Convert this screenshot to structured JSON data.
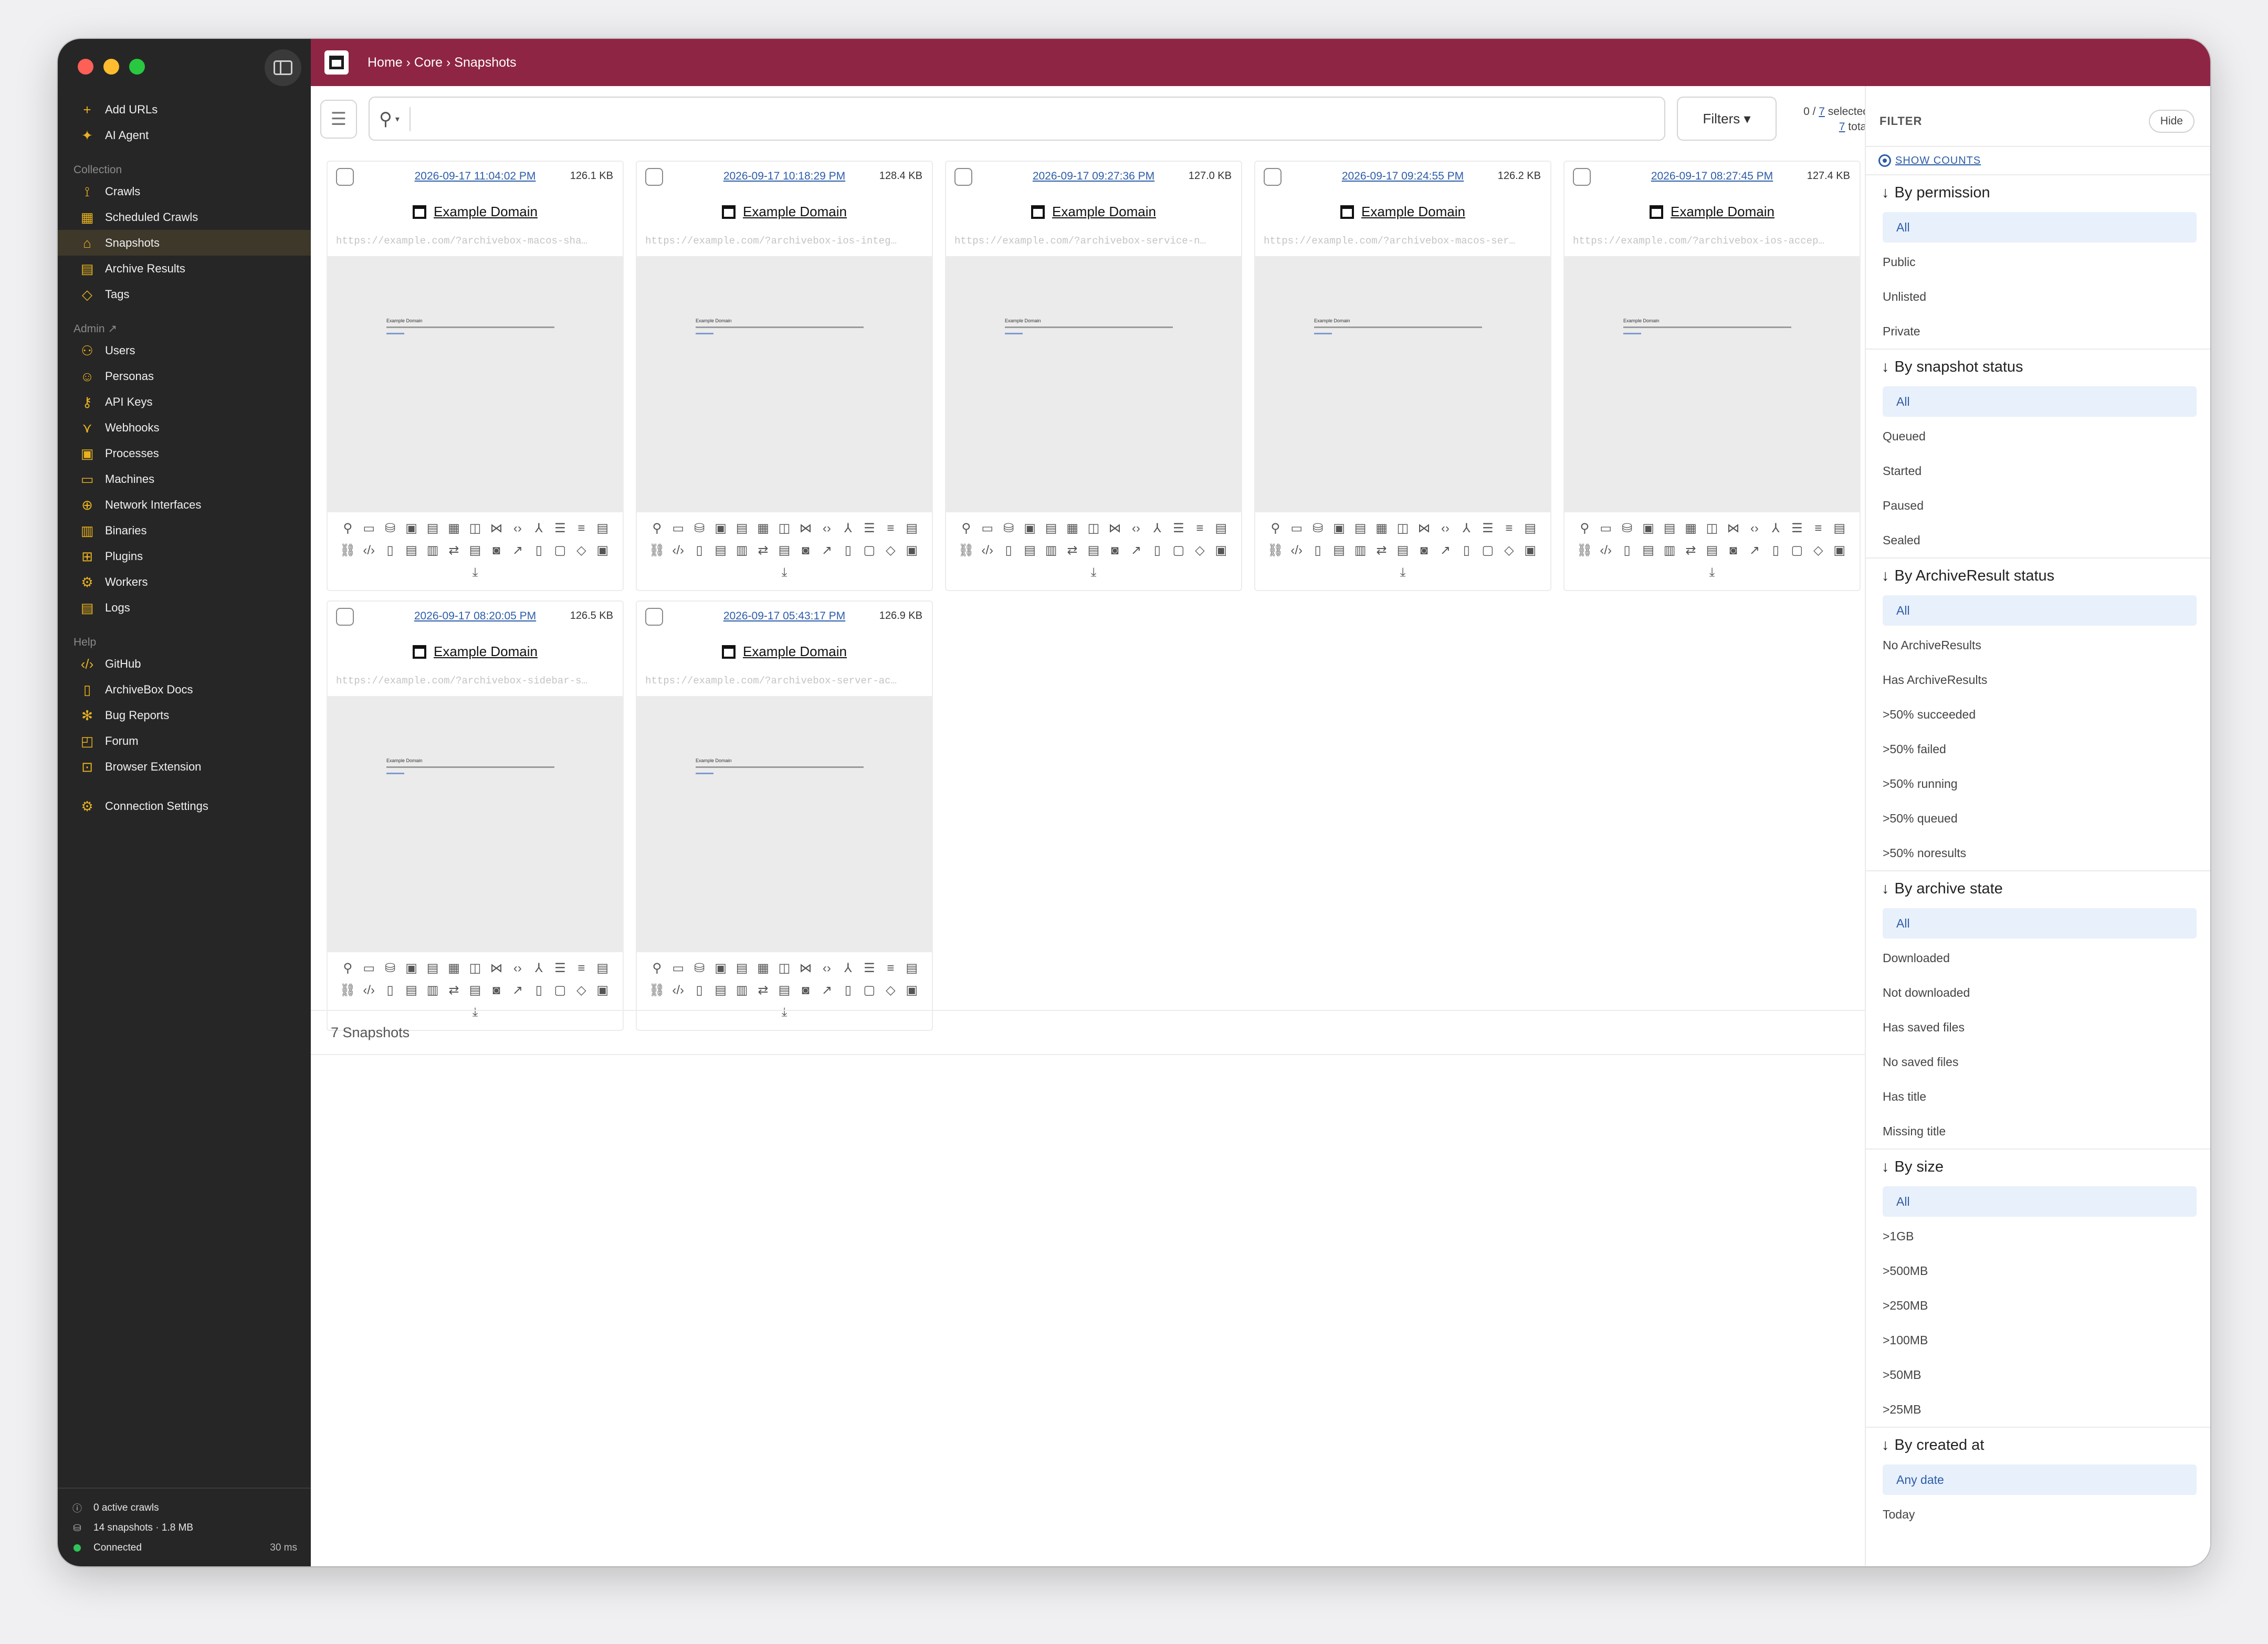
{
  "sidebar": {
    "quick": [
      {
        "label": "Add URLs",
        "icon": "plus-icon"
      },
      {
        "label": "AI Agent",
        "icon": "sparkle-icon"
      }
    ],
    "collection_title": "Collection",
    "collection": [
      {
        "label": "Crawls",
        "icon": "crawl-icon"
      },
      {
        "label": "Scheduled Crawls",
        "icon": "calendar-icon"
      },
      {
        "label": "Snapshots",
        "icon": "archive-icon",
        "active": true
      },
      {
        "label": "Archive Results",
        "icon": "results-icon"
      },
      {
        "label": "Tags",
        "icon": "tag-icon"
      }
    ],
    "admin_title": "Admin ↗",
    "admin": [
      {
        "label": "Users",
        "icon": "users-icon"
      },
      {
        "label": "Personas",
        "icon": "persona-icon"
      },
      {
        "label": "API Keys",
        "icon": "key-icon"
      },
      {
        "label": "Webhooks",
        "icon": "webhook-icon"
      },
      {
        "label": "Processes",
        "icon": "process-icon"
      },
      {
        "label": "Machines",
        "icon": "monitor-icon"
      },
      {
        "label": "Network Interfaces",
        "icon": "globe-icon"
      },
      {
        "label": "Binaries",
        "icon": "binary-icon"
      },
      {
        "label": "Plugins",
        "icon": "plugin-icon"
      },
      {
        "label": "Workers",
        "icon": "workers-icon"
      },
      {
        "label": "Logs",
        "icon": "log-icon"
      }
    ],
    "help_title": "Help",
    "help": [
      {
        "label": "GitHub",
        "icon": "code-icon"
      },
      {
        "label": "ArchiveBox Docs",
        "icon": "book-icon"
      },
      {
        "label": "Bug Reports",
        "icon": "bug-icon"
      },
      {
        "label": "Forum",
        "icon": "chat-icon"
      },
      {
        "label": "Browser Extension",
        "icon": "extension-icon"
      }
    ],
    "settings": {
      "label": "Connection Settings",
      "icon": "gear-icon"
    },
    "footer": {
      "active_crawls": "0 active crawls",
      "snapshots": "14 snapshots · 1.8 MB",
      "status": "Connected",
      "latency": "30 ms"
    }
  },
  "header": {
    "breadcrumb": "Home › Core › Snapshots"
  },
  "toolbar": {
    "search_placeholder": "",
    "filters_label": "Filters ▾",
    "selected_prefix": "0 / ",
    "selected_count": "7",
    "selected_suffix": " selected",
    "total_count": "7",
    "total_suffix": " total"
  },
  "snapshots": [
    {
      "date": "2026-09-17 11:04:02 PM",
      "size": "126.1 KB",
      "title": "Example Domain",
      "url": "https://example.com/?archivebox-macos-sha…"
    },
    {
      "date": "2026-09-17 10:18:29 PM",
      "size": "128.4 KB",
      "title": "Example Domain",
      "url": "https://example.com/?archivebox-ios-integ…"
    },
    {
      "date": "2026-09-17 09:27:36 PM",
      "size": "127.0 KB",
      "title": "Example Domain",
      "url": "https://example.com/?archivebox-service-n…"
    },
    {
      "date": "2026-09-17 09:24:55 PM",
      "size": "126.2 KB",
      "title": "Example Domain",
      "url": "https://example.com/?archivebox-macos-ser…"
    },
    {
      "date": "2026-09-17 08:27:45 PM",
      "size": "127.4 KB",
      "title": "Example Domain",
      "url": "https://example.com/?archivebox-ios-accep…"
    },
    {
      "date": "2026-09-17 08:20:05 PM",
      "size": "126.5 KB",
      "title": "Example Domain",
      "url": "https://example.com/?archivebox-sidebar-s…"
    },
    {
      "date": "2026-09-17 05:43:17 PM",
      "size": "126.9 KB",
      "title": "Example Domain",
      "url": "https://example.com/?archivebox-server-ac…"
    }
  ],
  "thumb_heading": "Example Domain",
  "snapshot_count": "7 Snapshots",
  "filter": {
    "title": "FILTER",
    "hide_label": "Hide",
    "show_counts": "SHOW COUNTS",
    "groups": [
      {
        "title": "By permission",
        "options": [
          "All",
          "Public",
          "Unlisted",
          "Private"
        ],
        "selected": 0
      },
      {
        "title": "By snapshot status",
        "options": [
          "All",
          "Queued",
          "Started",
          "Paused",
          "Sealed"
        ],
        "selected": 0
      },
      {
        "title": "By ArchiveResult status",
        "options": [
          "All",
          "No ArchiveResults",
          "Has ArchiveResults",
          ">50% succeeded",
          ">50% failed",
          ">50% running",
          ">50% queued",
          ">50% noresults"
        ],
        "selected": 0
      },
      {
        "title": "By archive state",
        "options": [
          "All",
          "Downloaded",
          "Not downloaded",
          "Has saved files",
          "No saved files",
          "Has title",
          "Missing title"
        ],
        "selected": 0
      },
      {
        "title": "By size",
        "options": [
          "All",
          ">1GB",
          ">500MB",
          ">250MB",
          ">100MB",
          ">50MB",
          ">25MB"
        ],
        "selected": 0
      },
      {
        "title": "By created at",
        "options": [
          "Any date",
          "Today"
        ],
        "selected": 0
      }
    ]
  }
}
